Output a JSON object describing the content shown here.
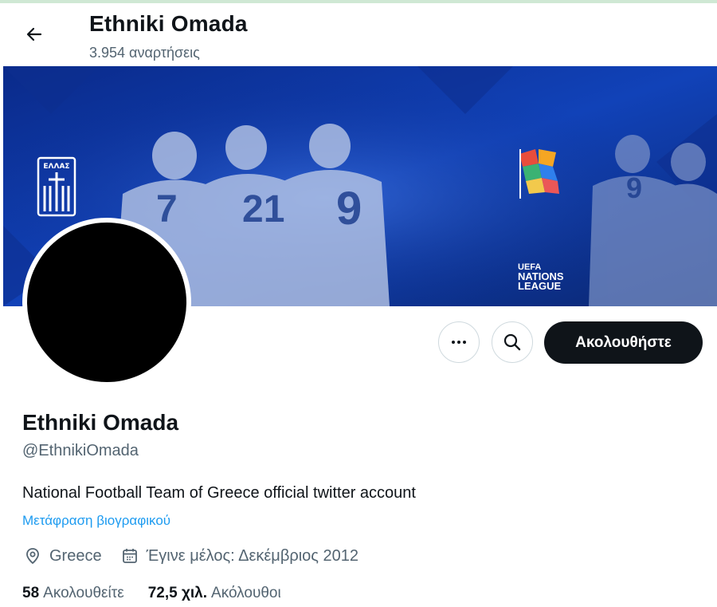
{
  "header": {
    "title": "Ethniki Omada",
    "posts_count": "3.954 αναρτήσεις",
    "back_icon": "arrow-left-icon"
  },
  "banner": {
    "crest_label": "ΕΛΛΑΣ",
    "league_line1": "UEFA",
    "league_line2": "NATIONS",
    "league_line3": "LEAGUE",
    "jersey_numbers": [
      "7",
      "21",
      "9",
      "9"
    ]
  },
  "actions": {
    "more_icon": "more-dots-icon",
    "search_icon": "search-icon",
    "follow_label": "Ακολουθήστε"
  },
  "profile": {
    "name": "Ethniki Omada",
    "handle": "@EthnikiOmada",
    "bio": "National Football Team of Greece official twitter account",
    "translate_link": "Μετάφραση βιογραφικού",
    "location": "Greece",
    "joined": "Έγινε μέλος: Δεκέμβριος 2012"
  },
  "stats": {
    "following_count": "58",
    "following_label": "Ακολουθείτε",
    "followers_count": "72,5 χιλ.",
    "followers_label": "Ακόλουθοι"
  },
  "colors": {
    "text_primary": "#0f1419",
    "text_secondary": "#536471",
    "link": "#1d9bf0",
    "banner_blue": "#0b2a7a"
  }
}
